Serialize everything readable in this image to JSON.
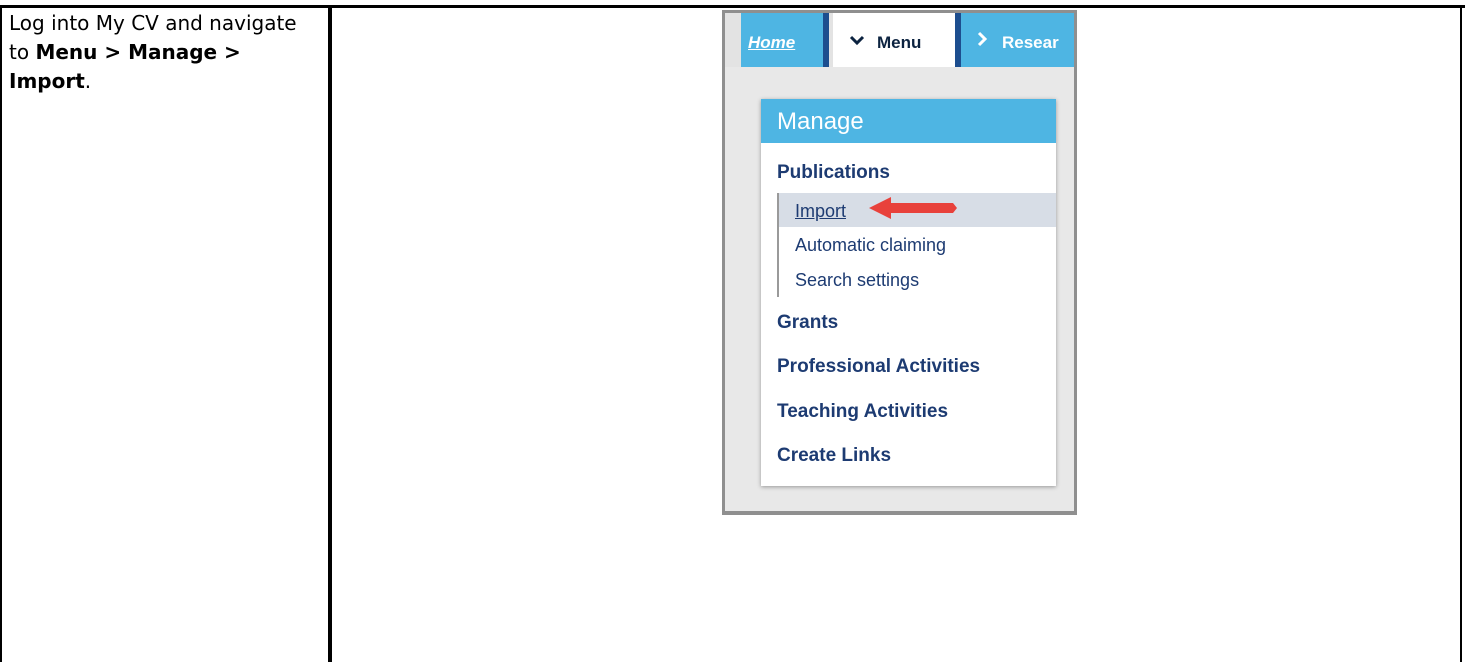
{
  "instruction": {
    "part1": "Log into My CV and navigate to ",
    "menu_path_1": "Menu > Manage > Import",
    "period": "."
  },
  "screenshot": {
    "tabs": {
      "home": "Home",
      "menu": "Menu",
      "research": "Resear"
    },
    "panel": {
      "title": "Manage",
      "publications": "Publications",
      "publications_items": [
        "Import",
        "Automatic claiming",
        "Search settings"
      ],
      "grants": "Grants",
      "professional_activities": "Professional Activities",
      "teaching_activities": "Teaching Activities",
      "create_links": "Create Links"
    },
    "colors": {
      "tab_blue": "#4eb5e3",
      "nav_text": "#1d3b72",
      "highlight": "#d7dde6",
      "arrow": "#e8413b"
    },
    "icons": {
      "menu_chevron": "chevron-down-icon",
      "research_chevron": "chevron-right-icon",
      "pointer": "red-arrow-icon"
    }
  }
}
